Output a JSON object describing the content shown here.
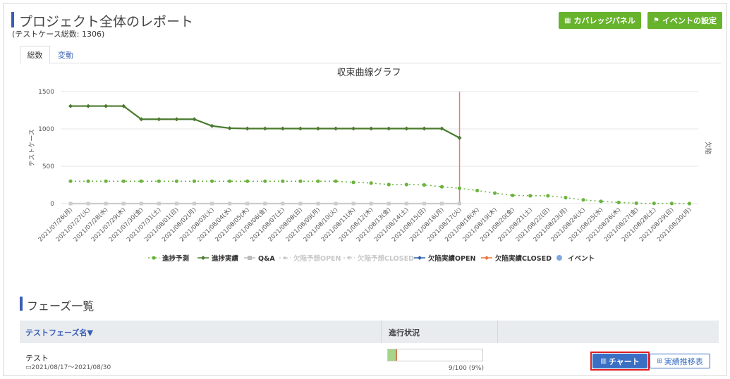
{
  "header": {
    "title": "プロジェクト全体のレポート",
    "subtitle": "(テストケース総数: 1306)",
    "coverage_button": "カバレッジパネル",
    "coverage_icon": "table-icon",
    "event_button": "イベントの設定",
    "event_icon": "flag-icon"
  },
  "tabs": [
    {
      "label": "総数",
      "active": true
    },
    {
      "label": "変動",
      "active": false
    }
  ],
  "chart_data": {
    "type": "line",
    "title": "収束曲線グラフ",
    "ylabel": "テストケース",
    "y2label": "欠陥",
    "ylim": [
      0,
      1500
    ],
    "yticks": [
      0,
      500,
      1000,
      1500
    ],
    "categories": [
      "2021/07/26(月)",
      "2021/07/27(火)",
      "2021/07/28(水)",
      "2021/07/29(木)",
      "2021/07/30(金)",
      "2021/07/31(土)",
      "2021/08/01(日)",
      "2021/08/02(月)",
      "2021/08/03(火)",
      "2021/08/04(水)",
      "2021/08/05(木)",
      "2021/08/06(金)",
      "2021/08/07(土)",
      "2021/08/08(日)",
      "2021/08/09(月)",
      "2021/08/10(火)",
      "2021/08/11(水)",
      "2021/08/12(木)",
      "2021/08/13(金)",
      "2021/08/14(土)",
      "2021/08/15(日)",
      "2021/08/16(月)",
      "2021/08/17(火)",
      "2021/08/18(水)",
      "2021/08/19(木)",
      "2021/08/20(金)",
      "2021/08/21(土)",
      "2021/08/22(日)",
      "2021/08/23(月)",
      "2021/08/24(火)",
      "2021/08/25(水)",
      "2021/08/26(木)",
      "2021/08/27(金)",
      "2021/08/28(土)",
      "2021/08/29(日)",
      "2021/08/30(月)"
    ],
    "today_index": 22,
    "today_color": "#ee7b7b",
    "series": [
      {
        "name": "進捗予測",
        "color": "#6cb33f",
        "style": "dotted",
        "marker": "circle",
        "values": [
          300,
          300,
          300,
          300,
          300,
          300,
          300,
          300,
          300,
          300,
          300,
          300,
          300,
          300,
          300,
          300,
          285,
          275,
          255,
          255,
          250,
          225,
          205,
          175,
          140,
          110,
          105,
          105,
          80,
          50,
          30,
          15,
          5,
          3,
          2,
          0
        ]
      },
      {
        "name": "進捗実績",
        "color": "#4a7a2e",
        "style": "solid",
        "marker": "diamond",
        "values": [
          1306,
          1306,
          1306,
          1306,
          1130,
          1130,
          1130,
          1130,
          1040,
          1010,
          1005,
          1005,
          1005,
          1005,
          1005,
          1005,
          1005,
          1005,
          1005,
          1005,
          1005,
          1005,
          880
        ]
      },
      {
        "name": "Q&A",
        "color": "#cccccc",
        "style": "solid",
        "marker": "square",
        "values": [
          0,
          0,
          0,
          0,
          0,
          0,
          0,
          0,
          0,
          0,
          0,
          0,
          0,
          0,
          0,
          0,
          0,
          0,
          0,
          0,
          0,
          0,
          0
        ]
      }
    ],
    "legend": [
      {
        "name": "進捗予測",
        "color": "#6cb33f",
        "marker": "circle",
        "line": "dotted",
        "muted": false
      },
      {
        "name": "進捗実績",
        "color": "#4a7a2e",
        "marker": "diamond",
        "line": "solid",
        "muted": false
      },
      {
        "name": "Q&A",
        "color": "#bbbbbb",
        "marker": "square",
        "line": "solid",
        "muted": false
      },
      {
        "name": "欠陥予想OPEN",
        "color": "#cccccc",
        "marker": "triangle-up",
        "line": "dotted",
        "muted": true
      },
      {
        "name": "欠陥予想CLOSED",
        "color": "#cccccc",
        "marker": "triangle-down",
        "line": "dotted",
        "muted": true
      },
      {
        "name": "欠陥実績OPEN",
        "color": "#2c5fa8",
        "marker": "diamond",
        "line": "solid",
        "muted": false
      },
      {
        "name": "欠陥実績CLOSED",
        "color": "#e8743b",
        "marker": "diamond",
        "line": "solid",
        "muted": false
      },
      {
        "name": "イベント",
        "color": "#7fa8e0",
        "marker": "circle",
        "line": "none",
        "muted": false
      }
    ],
    "legend_position": "bottom"
  },
  "phases": {
    "title": "フェーズ一覧",
    "col_name": "テストフェーズ名▼",
    "col_progress": "進行状況",
    "rows": [
      {
        "name": "テスト",
        "date_icon": "calendar-icon",
        "date_range": "2021/08/17～2021/08/30",
        "progress_fraction": 0.09,
        "progress_text": "9/100 (9%)",
        "chart_button": "チャート",
        "chart_icon": "bar-chart-icon",
        "trans_button": "実績推移表",
        "trans_icon": "table-icon"
      }
    ]
  }
}
